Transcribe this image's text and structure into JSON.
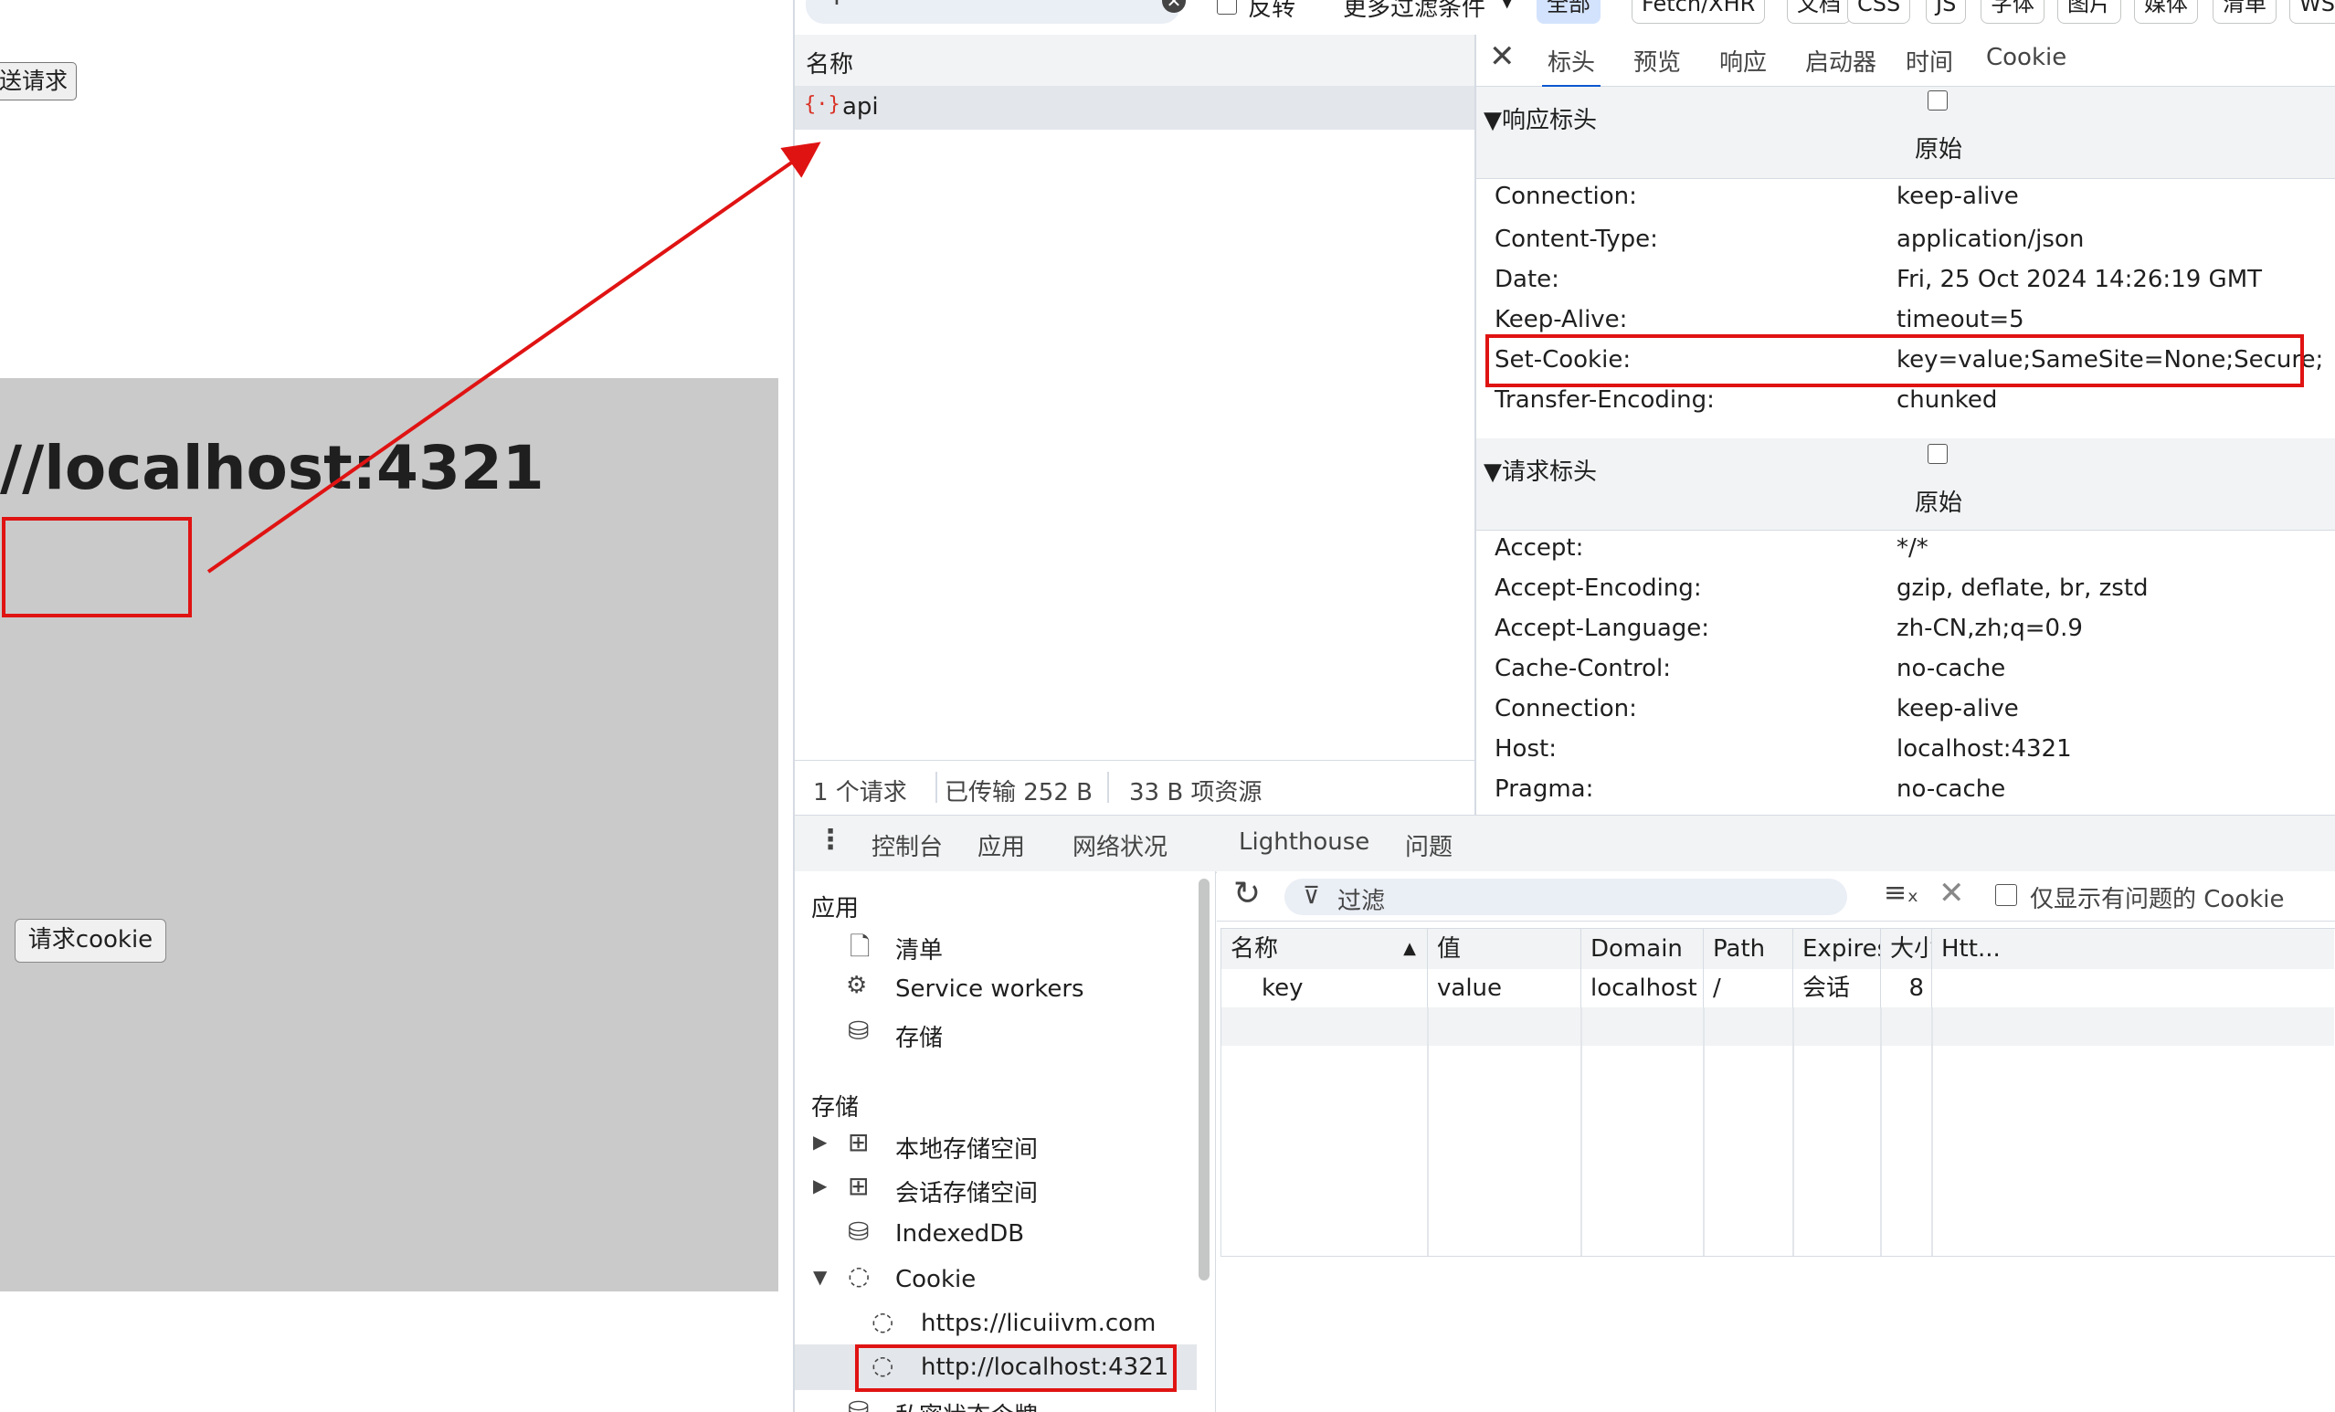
{
  "left_page": {
    "send_button_label": "送请求",
    "heading": "//localhost:4321",
    "request_cookie_button": "请求cookie",
    "colors": {
      "gray_area": "#cacaca",
      "annotation_red": "#e01313"
    }
  },
  "network": {
    "filter_chips": {
      "invert_label": "反转",
      "more_filters": "更多过滤条件",
      "all": "全部",
      "fetch_xhr": "Fetch/XHR",
      "doc": "文档",
      "css": "CSS",
      "js": "JS",
      "font": "字体",
      "img": "图片",
      "media": "媒体",
      "manifest": "清单",
      "ws": "WS"
    },
    "name_column_header": "名称",
    "requests": [
      {
        "name": "api",
        "icon": "json-braces-icon"
      }
    ],
    "summary": {
      "request_count": "1 个请求",
      "transferred": "已传输 252 B",
      "resources": "33 B 项资源"
    }
  },
  "detail_tabs": {
    "headers": "标头",
    "preview": "预览",
    "response": "响应",
    "initiator": "启动器",
    "timing": "时间",
    "cookie": "Cookie"
  },
  "response_headers": {
    "section_title": "▼响应标头",
    "raw_label": "原始",
    "rows": [
      {
        "name": "Connection:",
        "value": "keep-alive"
      },
      {
        "name": "Content-Type:",
        "value": "application/json"
      },
      {
        "name": "Date:",
        "value": "Fri, 25 Oct 2024 14:26:19 GMT"
      },
      {
        "name": "Keep-Alive:",
        "value": "timeout=5"
      },
      {
        "name": "Set-Cookie:",
        "value": "key=value;SameSite=None;Secure;"
      },
      {
        "name": "Transfer-Encoding:",
        "value": "chunked"
      }
    ]
  },
  "request_headers": {
    "section_title": "▼请求标头",
    "raw_label": "原始",
    "rows": [
      {
        "name": "Accept:",
        "value": "*/*"
      },
      {
        "name": "Accept-Encoding:",
        "value": "gzip, deflate, br, zstd"
      },
      {
        "name": "Accept-Language:",
        "value": "zh-CN,zh;q=0.9"
      },
      {
        "name": "Cache-Control:",
        "value": "no-cache"
      },
      {
        "name": "Connection:",
        "value": "keep-alive"
      },
      {
        "name": "Host:",
        "value": "localhost:4321"
      },
      {
        "name": "Pragma:",
        "value": "no-cache"
      }
    ]
  },
  "drawer": {
    "tabs": {
      "console": "控制台",
      "application": "应用",
      "network_conditions": "网络状况",
      "lighthouse": "Lighthouse",
      "issues": "问题"
    }
  },
  "app_sidebar": {
    "application_section": "应用",
    "manifest": "清单",
    "service_workers": "Service workers",
    "storage_item": "存储",
    "storage_section": "存储",
    "local_storage": "本地存储空间",
    "session_storage": "会话存储空间",
    "indexeddb": "IndexedDB",
    "cookie": "Cookie",
    "cookie_origin_1": "https://licuiivm.com",
    "cookie_origin_2": "http://localhost:4321",
    "private_state_tokens": "私密状态令牌"
  },
  "cookie_panel": {
    "filter_placeholder": "过滤",
    "only_issues_label": "仅显示有问题的 Cookie",
    "columns": {
      "name": "名称",
      "value": "值",
      "domain": "Domain",
      "path": "Path",
      "expires": "Expires / ...",
      "size": "大小",
      "httponly": "Htt..."
    },
    "rows": [
      {
        "name": "key",
        "value": "value",
        "domain": "localhost",
        "path": "/",
        "expires": "会话",
        "size": "8"
      }
    ]
  }
}
